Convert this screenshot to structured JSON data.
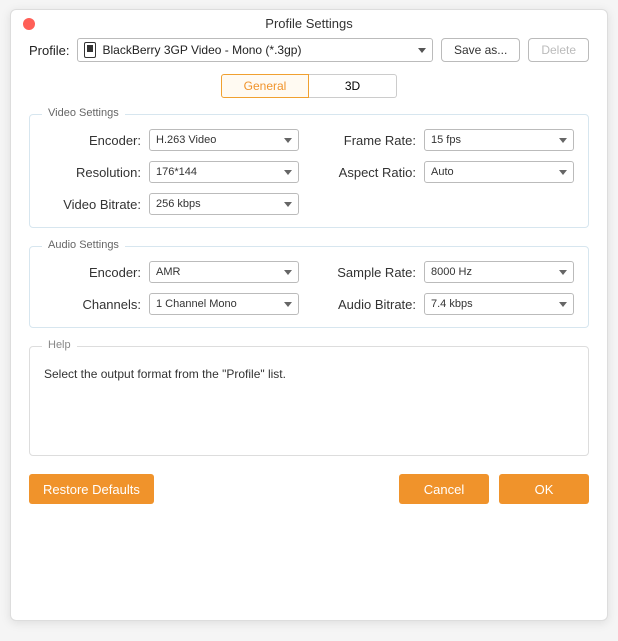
{
  "window": {
    "title": "Profile Settings"
  },
  "profile": {
    "label": "Profile:",
    "selected": "BlackBerry 3GP Video - Mono (*.3gp)",
    "save_as": "Save as...",
    "delete": "Delete"
  },
  "tabs": {
    "general": "General",
    "three_d": "3D"
  },
  "video": {
    "title": "Video Settings",
    "encoder_label": "Encoder:",
    "encoder": "H.263 Video",
    "frame_rate_label": "Frame Rate:",
    "frame_rate": "15 fps",
    "resolution_label": "Resolution:",
    "resolution": "176*144",
    "aspect_ratio_label": "Aspect Ratio:",
    "aspect_ratio": "Auto",
    "bitrate_label": "Video Bitrate:",
    "bitrate": "256 kbps"
  },
  "audio": {
    "title": "Audio Settings",
    "encoder_label": "Encoder:",
    "encoder": "AMR",
    "sample_rate_label": "Sample Rate:",
    "sample_rate": "8000 Hz",
    "channels_label": "Channels:",
    "channels": "1 Channel Mono",
    "bitrate_label": "Audio Bitrate:",
    "bitrate": "7.4 kbps"
  },
  "help": {
    "title": "Help",
    "text": "Select the output format from the \"Profile\" list."
  },
  "buttons": {
    "restore": "Restore Defaults",
    "cancel": "Cancel",
    "ok": "OK"
  }
}
